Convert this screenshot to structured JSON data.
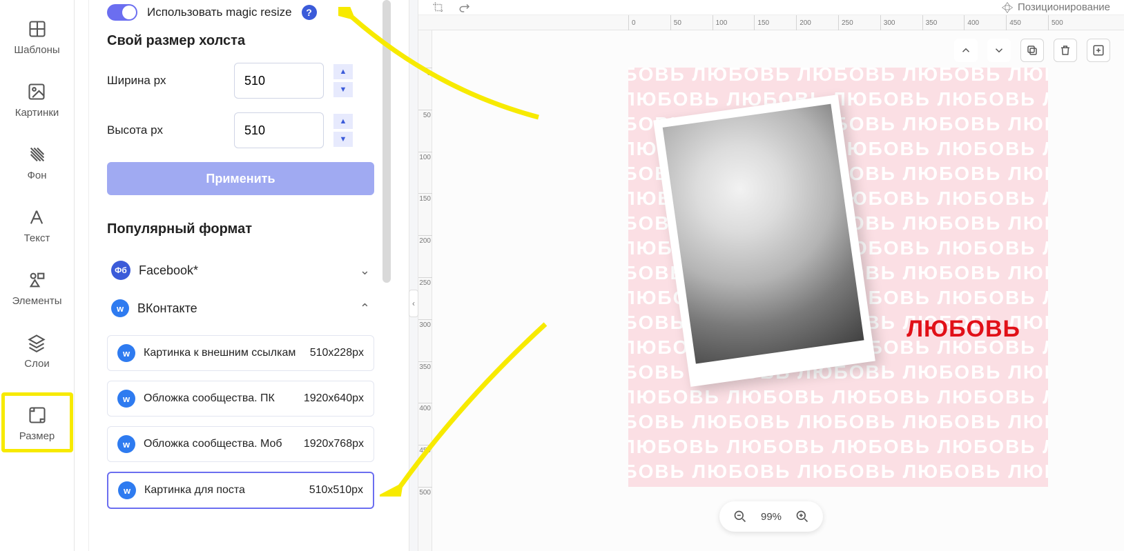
{
  "nav": {
    "items": [
      {
        "label": "Шаблоны",
        "icon": "templates-icon"
      },
      {
        "label": "Картинки",
        "icon": "images-icon"
      },
      {
        "label": "Фон",
        "icon": "background-icon"
      },
      {
        "label": "Текст",
        "icon": "text-icon"
      },
      {
        "label": "Элементы",
        "icon": "elements-icon"
      },
      {
        "label": "Слои",
        "icon": "layers-icon"
      },
      {
        "label": "Размер",
        "icon": "size-icon",
        "active": true
      }
    ]
  },
  "panel": {
    "magic_resize_label": "Использовать magic resize",
    "magic_resize_on": true,
    "help_char": "?",
    "custom_size_title": "Свой размер холста",
    "width_label": "Ширина px",
    "width_value": "510",
    "height_label": "Высота px",
    "height_value": "510",
    "apply_label": "Применить",
    "popular_title": "Популярный формат",
    "groups": [
      {
        "name": "Facebook*",
        "badge": "Фб",
        "expanded": false
      },
      {
        "name": "ВКонтакте",
        "badge": "w",
        "expanded": true
      }
    ],
    "presets": [
      {
        "name": "Картинка к внешним ссылкам",
        "size": "510x228px"
      },
      {
        "name": "Обложка сообщества. ПК",
        "size": "1920x640px"
      },
      {
        "name": "Обложка сообщества. Моб",
        "size": "1920x768px"
      },
      {
        "name": "Картинка для поста",
        "size": "510x510px",
        "selected": true
      }
    ]
  },
  "workspace": {
    "ruler_h": [
      "0",
      "50",
      "100",
      "150",
      "200",
      "250",
      "300",
      "350",
      "400",
      "450",
      "500"
    ],
    "ruler_v": [
      "0",
      "50",
      "100",
      "150",
      "200",
      "250",
      "300",
      "350",
      "400",
      "450",
      "500"
    ],
    "positioning_label": "Позиционирование",
    "canvas": {
      "bg_word": "ЛЮБОВЬ",
      "headline": "ЛЮБОВЬ"
    },
    "zoom_value": "99%"
  },
  "colors": {
    "accent": "#6b6ef0",
    "accent_soft": "#a0aaf2",
    "highlight": "#f7ea00",
    "vk_blue": "#2e7bf0",
    "headline_red": "#e11018",
    "canvas_pink": "#fbdfe4"
  }
}
